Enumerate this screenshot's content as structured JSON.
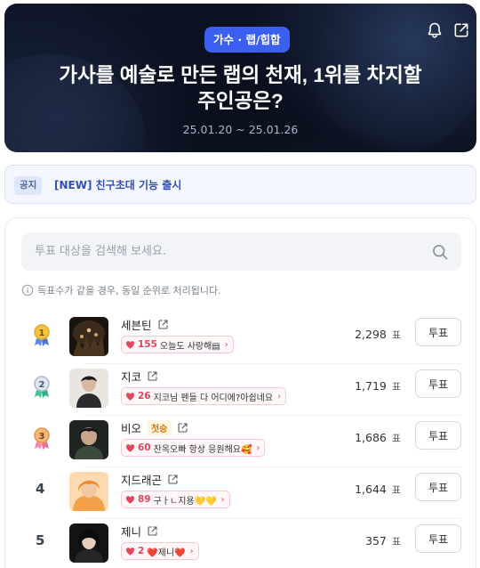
{
  "banner": {
    "category": "가수 · 랩/힙합",
    "title_line1": "가사를 예술로 만든 랩의 천재, 1위를 차지할",
    "title_line2": "주인공은?",
    "dates": "25.01.20 ~ 25.01.26",
    "icons": [
      "bell-icon",
      "share-icon"
    ]
  },
  "notice": {
    "tag": "공지",
    "text": "[NEW] 친구초대 기능 출시"
  },
  "search": {
    "placeholder": "투표 대상을 검색해 보세요."
  },
  "info_text": "득표수가 같을 경우, 동일 순위로 처리됩니다.",
  "vote_unit": "표",
  "vote_label": "투표",
  "colors": {
    "accent": "#3b5ff0",
    "gold": "#e7b533",
    "silver": "#9fb3c8",
    "bronze": "#e39a5a",
    "heart": "#e0465c"
  },
  "candidates": [
    {
      "rank": "1",
      "name": "세븐틴",
      "badge": "",
      "cheer_count": "155",
      "cheer_msg": "오늘도 사랑해▤",
      "votes": "2,298"
    },
    {
      "rank": "2",
      "name": "지코",
      "badge": "",
      "cheer_count": "26",
      "cheer_msg": "지코님 펜들 다 어디에?아쉽네요",
      "votes": "1,719"
    },
    {
      "rank": "3",
      "name": "비오",
      "badge": "첫승",
      "cheer_count": "60",
      "cheer_msg": "찬옥오빠 항상 응원해요🥰",
      "votes": "1,686"
    },
    {
      "rank": "4",
      "name": "지드래곤",
      "badge": "",
      "cheer_count": "89",
      "cheer_msg": "구ㅏㄴ지용💛💛",
      "votes": "1,644"
    },
    {
      "rank": "5",
      "name": "제니",
      "badge": "",
      "cheer_count": "2",
      "cheer_msg": "❤️제니❤️",
      "votes": "357"
    }
  ]
}
